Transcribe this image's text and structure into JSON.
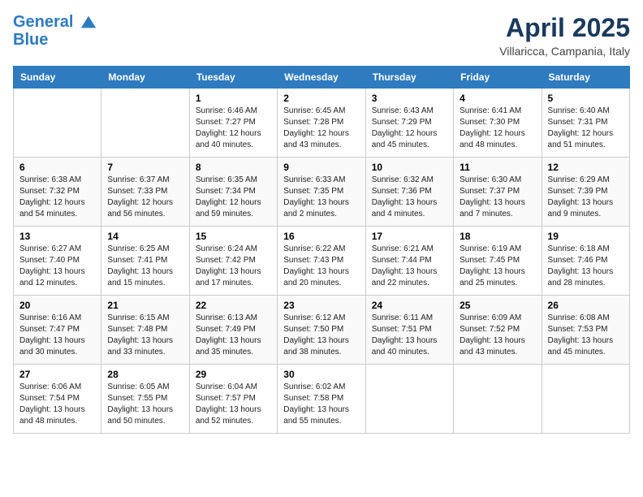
{
  "header": {
    "logo_line1": "General",
    "logo_line2": "Blue",
    "month": "April 2025",
    "location": "Villaricca, Campania, Italy"
  },
  "days_of_week": [
    "Sunday",
    "Monday",
    "Tuesday",
    "Wednesday",
    "Thursday",
    "Friday",
    "Saturday"
  ],
  "weeks": [
    [
      {
        "day": "",
        "info": ""
      },
      {
        "day": "",
        "info": ""
      },
      {
        "day": "1",
        "info": "Sunrise: 6:46 AM\nSunset: 7:27 PM\nDaylight: 12 hours and 40 minutes."
      },
      {
        "day": "2",
        "info": "Sunrise: 6:45 AM\nSunset: 7:28 PM\nDaylight: 12 hours and 43 minutes."
      },
      {
        "day": "3",
        "info": "Sunrise: 6:43 AM\nSunset: 7:29 PM\nDaylight: 12 hours and 45 minutes."
      },
      {
        "day": "4",
        "info": "Sunrise: 6:41 AM\nSunset: 7:30 PM\nDaylight: 12 hours and 48 minutes."
      },
      {
        "day": "5",
        "info": "Sunrise: 6:40 AM\nSunset: 7:31 PM\nDaylight: 12 hours and 51 minutes."
      }
    ],
    [
      {
        "day": "6",
        "info": "Sunrise: 6:38 AM\nSunset: 7:32 PM\nDaylight: 12 hours and 54 minutes."
      },
      {
        "day": "7",
        "info": "Sunrise: 6:37 AM\nSunset: 7:33 PM\nDaylight: 12 hours and 56 minutes."
      },
      {
        "day": "8",
        "info": "Sunrise: 6:35 AM\nSunset: 7:34 PM\nDaylight: 12 hours and 59 minutes."
      },
      {
        "day": "9",
        "info": "Sunrise: 6:33 AM\nSunset: 7:35 PM\nDaylight: 13 hours and 2 minutes."
      },
      {
        "day": "10",
        "info": "Sunrise: 6:32 AM\nSunset: 7:36 PM\nDaylight: 13 hours and 4 minutes."
      },
      {
        "day": "11",
        "info": "Sunrise: 6:30 AM\nSunset: 7:37 PM\nDaylight: 13 hours and 7 minutes."
      },
      {
        "day": "12",
        "info": "Sunrise: 6:29 AM\nSunset: 7:39 PM\nDaylight: 13 hours and 9 minutes."
      }
    ],
    [
      {
        "day": "13",
        "info": "Sunrise: 6:27 AM\nSunset: 7:40 PM\nDaylight: 13 hours and 12 minutes."
      },
      {
        "day": "14",
        "info": "Sunrise: 6:25 AM\nSunset: 7:41 PM\nDaylight: 13 hours and 15 minutes."
      },
      {
        "day": "15",
        "info": "Sunrise: 6:24 AM\nSunset: 7:42 PM\nDaylight: 13 hours and 17 minutes."
      },
      {
        "day": "16",
        "info": "Sunrise: 6:22 AM\nSunset: 7:43 PM\nDaylight: 13 hours and 20 minutes."
      },
      {
        "day": "17",
        "info": "Sunrise: 6:21 AM\nSunset: 7:44 PM\nDaylight: 13 hours and 22 minutes."
      },
      {
        "day": "18",
        "info": "Sunrise: 6:19 AM\nSunset: 7:45 PM\nDaylight: 13 hours and 25 minutes."
      },
      {
        "day": "19",
        "info": "Sunrise: 6:18 AM\nSunset: 7:46 PM\nDaylight: 13 hours and 28 minutes."
      }
    ],
    [
      {
        "day": "20",
        "info": "Sunrise: 6:16 AM\nSunset: 7:47 PM\nDaylight: 13 hours and 30 minutes."
      },
      {
        "day": "21",
        "info": "Sunrise: 6:15 AM\nSunset: 7:48 PM\nDaylight: 13 hours and 33 minutes."
      },
      {
        "day": "22",
        "info": "Sunrise: 6:13 AM\nSunset: 7:49 PM\nDaylight: 13 hours and 35 minutes."
      },
      {
        "day": "23",
        "info": "Sunrise: 6:12 AM\nSunset: 7:50 PM\nDaylight: 13 hours and 38 minutes."
      },
      {
        "day": "24",
        "info": "Sunrise: 6:11 AM\nSunset: 7:51 PM\nDaylight: 13 hours and 40 minutes."
      },
      {
        "day": "25",
        "info": "Sunrise: 6:09 AM\nSunset: 7:52 PM\nDaylight: 13 hours and 43 minutes."
      },
      {
        "day": "26",
        "info": "Sunrise: 6:08 AM\nSunset: 7:53 PM\nDaylight: 13 hours and 45 minutes."
      }
    ],
    [
      {
        "day": "27",
        "info": "Sunrise: 6:06 AM\nSunset: 7:54 PM\nDaylight: 13 hours and 48 minutes."
      },
      {
        "day": "28",
        "info": "Sunrise: 6:05 AM\nSunset: 7:55 PM\nDaylight: 13 hours and 50 minutes."
      },
      {
        "day": "29",
        "info": "Sunrise: 6:04 AM\nSunset: 7:57 PM\nDaylight: 13 hours and 52 minutes."
      },
      {
        "day": "30",
        "info": "Sunrise: 6:02 AM\nSunset: 7:58 PM\nDaylight: 13 hours and 55 minutes."
      },
      {
        "day": "",
        "info": ""
      },
      {
        "day": "",
        "info": ""
      },
      {
        "day": "",
        "info": ""
      }
    ]
  ]
}
